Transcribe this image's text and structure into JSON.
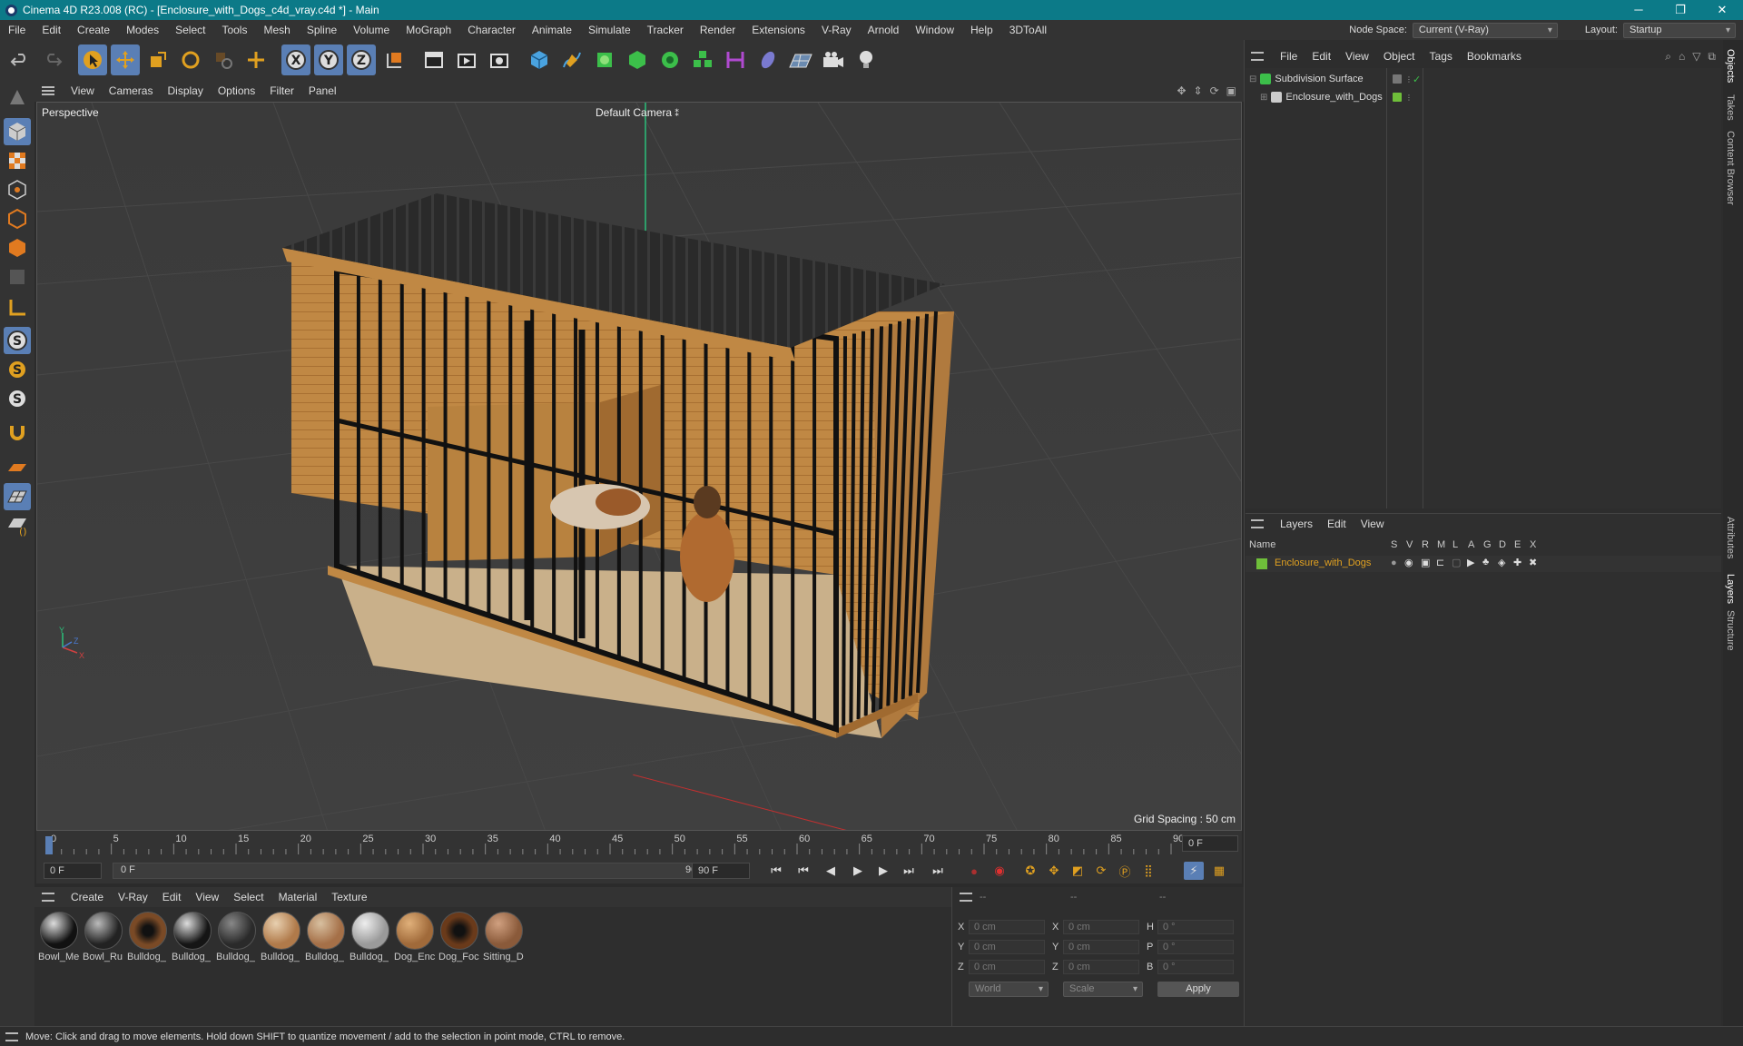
{
  "window": {
    "title": "Cinema 4D R23.008 (RC) - [Enclosure_with_Dogs_c4d_vray.c4d *] - Main",
    "min": "─",
    "max": "❐",
    "close": "✕"
  },
  "menubar": {
    "items": [
      "File",
      "Edit",
      "Create",
      "Modes",
      "Select",
      "Tools",
      "Mesh",
      "Spline",
      "Volume",
      "MoGraph",
      "Character",
      "Animate",
      "Simulate",
      "Tracker",
      "Render",
      "Extensions",
      "V-Ray",
      "Arnold",
      "Window",
      "Help",
      "3DToAll"
    ],
    "node_space_label": "Node Space:",
    "node_space_value": "Current (V-Ray)",
    "layout_label": "Layout:",
    "layout_value": "Startup"
  },
  "viewport": {
    "menu": [
      "View",
      "Cameras",
      "Display",
      "Options",
      "Filter",
      "Panel"
    ],
    "label": "Perspective",
    "camera": "Default Camera",
    "grid_spacing": "Grid Spacing : 50 cm",
    "axis_x": "X",
    "axis_y": "Y",
    "axis_z": "Z"
  },
  "timeline": {
    "ticks": [
      "0",
      "5",
      "10",
      "15",
      "20",
      "25",
      "30",
      "35",
      "40",
      "45",
      "50",
      "55",
      "60",
      "65",
      "70",
      "75",
      "80",
      "85",
      "90"
    ],
    "current_frame_right": "0 F",
    "start_field": "0 F",
    "range_start": "0 F",
    "range_end": "90 F",
    "end_field": "90 F"
  },
  "materials": {
    "menu": [
      "Create",
      "V-Ray",
      "Edit",
      "View",
      "Select",
      "Material",
      "Texture"
    ],
    "items": [
      {
        "label": "Bowl_Me",
        "color": "#111"
      },
      {
        "label": "Bowl_Ru",
        "color": "#222"
      },
      {
        "label": "Bulldog_",
        "color": "#7a4a26"
      },
      {
        "label": "Bulldog_",
        "color": "#151515"
      },
      {
        "label": "Bulldog_",
        "color": "#2a2a2a"
      },
      {
        "label": "Bulldog_",
        "color": "#b07a4a"
      },
      {
        "label": "Bulldog_",
        "color": "#a57048"
      },
      {
        "label": "Bulldog_",
        "color": "#9a9a9a"
      },
      {
        "label": "Dog_Enc",
        "color": "#a06a3a"
      },
      {
        "label": "Dog_Foc",
        "color": "#6a3a1a"
      },
      {
        "label": "Sitting_D",
        "color": "#8a5a3a"
      }
    ]
  },
  "attributes": {
    "header": [
      "--",
      "--",
      "--"
    ],
    "rows": [
      {
        "a": "X",
        "av": "0 cm",
        "b": "X",
        "bv": "0 cm",
        "c": "H",
        "cv": "0 °"
      },
      {
        "a": "Y",
        "av": "0 cm",
        "b": "Y",
        "bv": "0 cm",
        "c": "P",
        "cv": "0 °"
      },
      {
        "a": "Z",
        "av": "0 cm",
        "b": "Z",
        "bv": "0 cm",
        "c": "B",
        "cv": "0 °"
      }
    ],
    "coord_system": "World",
    "mode": "Scale",
    "apply": "Apply"
  },
  "objects": {
    "menu": [
      "File",
      "Edit",
      "View",
      "Object",
      "Tags",
      "Bookmarks"
    ],
    "items": [
      {
        "name": "Subdivision Surface"
      },
      {
        "name": "Enclosure_with_Dogs"
      }
    ]
  },
  "layers": {
    "menu": [
      "Layers",
      "Edit",
      "View"
    ],
    "columns": [
      "Name",
      "S",
      "V",
      "R",
      "M",
      "L",
      "A",
      "G",
      "D",
      "E",
      "X"
    ],
    "rows": [
      {
        "name": "Enclosure_with_Dogs",
        "color": "#6fbf3a"
      }
    ]
  },
  "sidetabs": [
    "Objects",
    "Takes",
    "Content Browser",
    "Attributes",
    "Layers",
    "Structure"
  ],
  "status": "Move: Click and drag to move elements. Hold down SHIFT to quantize movement / add to the selection in point mode, CTRL to remove."
}
